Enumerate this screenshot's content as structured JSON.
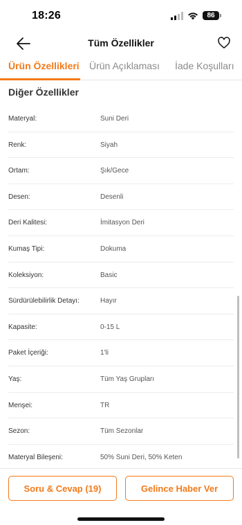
{
  "status_bar": {
    "time": "18:26",
    "battery": "86"
  },
  "header": {
    "title": "Tüm Özellikler",
    "back_icon": "arrow-left-icon",
    "favorite_icon": "heart-outline-icon"
  },
  "tabs": [
    {
      "label": "Ürün Özellikleri",
      "active": true
    },
    {
      "label": "Ürün Açıklaması",
      "active": false
    },
    {
      "label": "İade Koşulları",
      "active": false
    }
  ],
  "section": {
    "title": "Diğer Özellikler"
  },
  "attributes": [
    {
      "label": "Materyal:",
      "value": "Suni Deri"
    },
    {
      "label": "Renk:",
      "value": "Siyah"
    },
    {
      "label": "Ortam:",
      "value": "Şık/Gece"
    },
    {
      "label": "Desen:",
      "value": "Desenli"
    },
    {
      "label": "Deri Kalitesi:",
      "value": "İmitasyon Deri"
    },
    {
      "label": "Kumaş Tipi:",
      "value": "Dokuma"
    },
    {
      "label": "Koleksiyon:",
      "value": "Basic"
    },
    {
      "label": "Sürdürülebilirlik Detayı:",
      "value": "Hayır"
    },
    {
      "label": "Kapasite:",
      "value": "0-15 L"
    },
    {
      "label": "Paket İçeriği:",
      "value": "1'li"
    },
    {
      "label": "Yaş:",
      "value": "Tüm Yaş Grupları"
    },
    {
      "label": "Menşei:",
      "value": "TR"
    },
    {
      "label": "Sezon:",
      "value": "Tüm Sezonlar"
    },
    {
      "label": "Materyal Bileşeni:",
      "value": "50% Suni Deri, 50% Keten"
    }
  ],
  "bottom_bar": {
    "qa_button": "Soru & Cevap (19)",
    "notify_button": "Gelince Haber Ver"
  },
  "colors": {
    "accent": "#f27a1a",
    "divider": "#ececec",
    "text": "#333333"
  }
}
